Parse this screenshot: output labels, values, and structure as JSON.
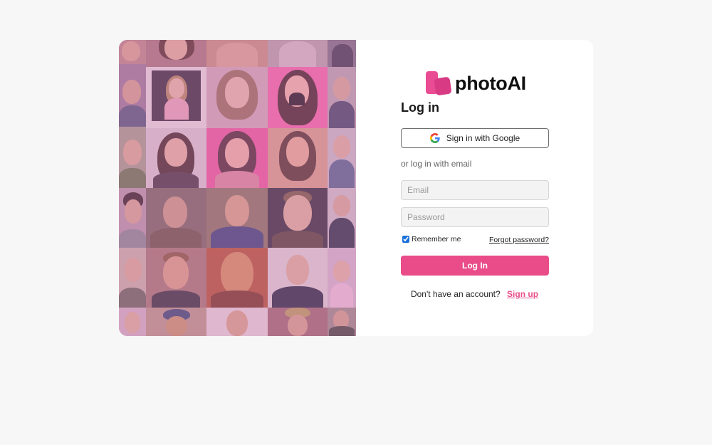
{
  "brand": {
    "name": "photoAI",
    "colors": {
      "primary": "#e94c93",
      "secondary": "#d83a84"
    }
  },
  "login": {
    "title": "Log in",
    "google_button_label": "Sign in with Google",
    "divider_text": "or log in with email",
    "email_placeholder": "Email",
    "password_placeholder": "Password",
    "remember_label": "Remember me",
    "remember_checked": true,
    "forgot_label": "Forgot password?",
    "submit_label": "Log In",
    "signup_prompt": "Don't have an account?",
    "signup_label": "Sign up"
  },
  "colors": {
    "page_background": "#f7f7f7",
    "card_background": "#ffffff",
    "accent": "#e94c88",
    "mosaic_tint": "#d678be"
  },
  "mosaic": {
    "icon": "portrait-photo-grid"
  }
}
